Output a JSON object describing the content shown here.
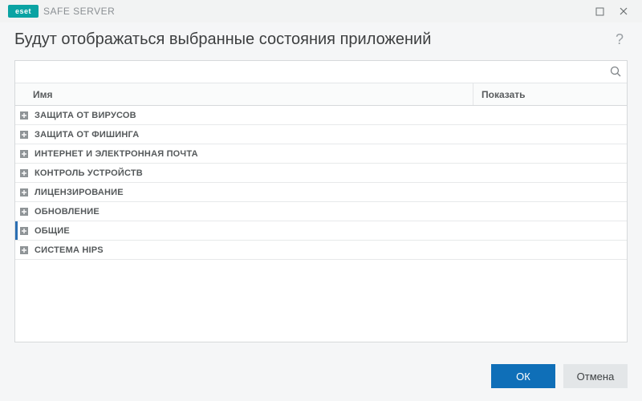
{
  "brand": {
    "logo_text": "eset",
    "product_name": "SAFE SERVER"
  },
  "header": {
    "title": "Будут отображаться выбранные состояния приложений",
    "help_char": "?"
  },
  "search": {
    "placeholder": ""
  },
  "columns": {
    "name": "Имя",
    "show": "Показать"
  },
  "rows": [
    {
      "label": "ЗАЩИТА ОТ ВИРУСОВ",
      "selected": false
    },
    {
      "label": "ЗАЩИТА ОТ ФИШИНГА",
      "selected": false
    },
    {
      "label": "ИНТЕРНЕТ И ЭЛЕКТРОННАЯ ПОЧТА",
      "selected": false
    },
    {
      "label": "КОНТРОЛЬ УСТРОЙСТВ",
      "selected": false
    },
    {
      "label": "ЛИЦЕНЗИРОВАНИЕ",
      "selected": false
    },
    {
      "label": "ОБНОВЛЕНИЕ",
      "selected": false
    },
    {
      "label": "ОБЩИЕ",
      "selected": true
    },
    {
      "label": "СИСТЕМА HIPS",
      "selected": false
    }
  ],
  "buttons": {
    "ok": "ОК",
    "cancel": "Отмена"
  }
}
